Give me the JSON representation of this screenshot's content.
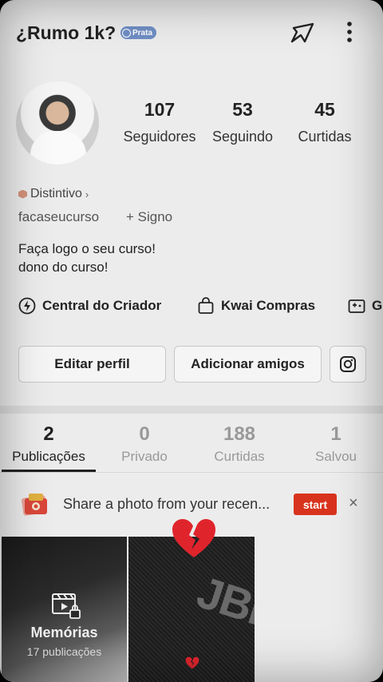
{
  "header": {
    "title": "¿Rumo 1k?",
    "badge": "Prata",
    "icons": [
      "share-icon",
      "more-icon"
    ]
  },
  "stats": [
    {
      "value": "107",
      "label": "Seguidores"
    },
    {
      "value": "53",
      "label": "Seguindo"
    },
    {
      "value": "45",
      "label": "Curtidas"
    }
  ],
  "profile": {
    "distintivo": "Distintivo",
    "username": "facaseucurso",
    "signo": "+ Signo",
    "bio_line1": "Faça logo o seu curso!",
    "bio_line2": "dono do curso!"
  },
  "creator_links": [
    {
      "label": "Central do Criador",
      "icon": "lightning-icon"
    },
    {
      "label": "Kwai Compras",
      "icon": "shopping-bag-icon"
    },
    {
      "label": "G",
      "icon": "gamepad-icon"
    }
  ],
  "actions": {
    "edit": "Editar perfil",
    "add_friends": "Adicionar amigos",
    "instagram_icon": "instagram-icon"
  },
  "tabs": [
    {
      "count": "2",
      "label": "Publicações",
      "active": true
    },
    {
      "count": "0",
      "label": "Privado"
    },
    {
      "count": "188",
      "label": "Curtidas"
    },
    {
      "count": "1",
      "label": "Salvou"
    }
  ],
  "banner": {
    "text": "Share a photo from your recen...",
    "button": "start",
    "close": "×"
  },
  "grid": {
    "memories_title": "Memórias",
    "memories_count": "17 publicações",
    "jbl_logo": "JBL"
  },
  "colors": {
    "accent_red": "#d8341d",
    "badge_blue": "#6f8ec4"
  }
}
